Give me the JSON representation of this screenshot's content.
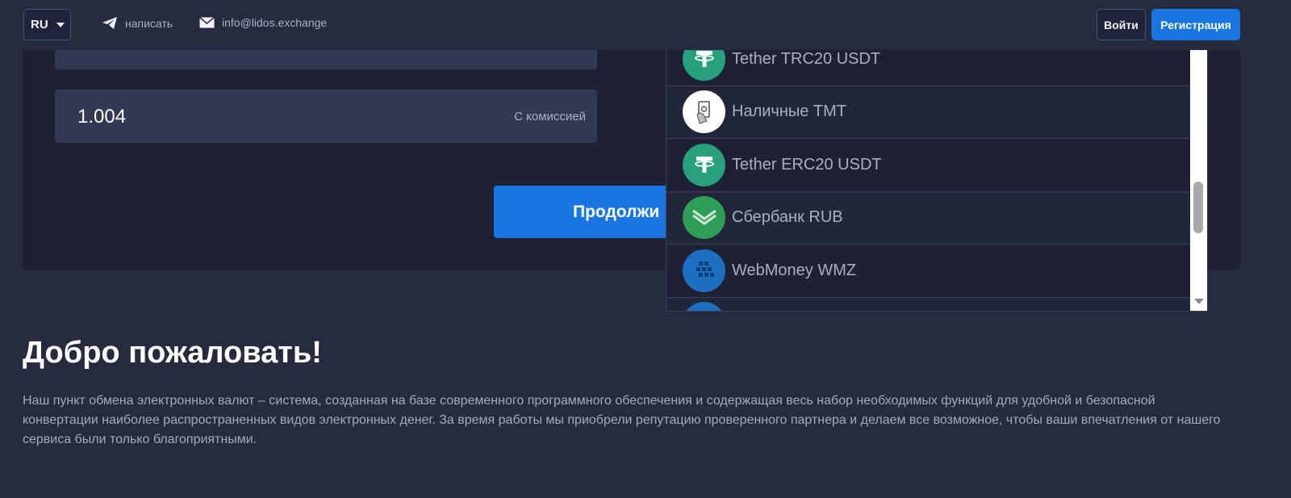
{
  "header": {
    "language": "RU",
    "contact_telegram": "написать",
    "contact_email": "info@lidos.exchange",
    "login_label": "Войти",
    "register_label": "Регистрация"
  },
  "exchange": {
    "amount_value": "1.004",
    "amount_note": "С комиссией",
    "continue_label": "Продолжи"
  },
  "dropdown": {
    "items": [
      {
        "label": "Tether TRC20 USDT",
        "icon": "tether-icon",
        "color": "#26a17b"
      },
      {
        "label": "Наличные ТМТ",
        "icon": "cash-hand-icon",
        "color": "#ffffff"
      },
      {
        "label": "Tether ERC20 USDT",
        "icon": "tether-icon",
        "color": "#26a17b"
      },
      {
        "label": "Сбербанк RUB",
        "icon": "sberbank-icon",
        "color": "#2e9e57"
      },
      {
        "label": "WebMoney WMZ",
        "icon": "webmoney-icon",
        "color": "#1f6fc1"
      }
    ]
  },
  "welcome": {
    "title": "Добро пожаловать!",
    "text": "Наш пункт обмена электронных валют – система, созданная на базе современного программного обеспечения и содержащая весь набор необходимых функций для удобной и безопасной конвертации наиболее распространенных видов электронных денег. За время работы мы приобрели репутацию проверенного партнера и делаем все возможное, чтобы ваши впечатления от нашего сервиса были только благоприятными."
  },
  "colors": {
    "background": "#272b40",
    "card": "#1e2134",
    "accent": "#1976e0"
  }
}
